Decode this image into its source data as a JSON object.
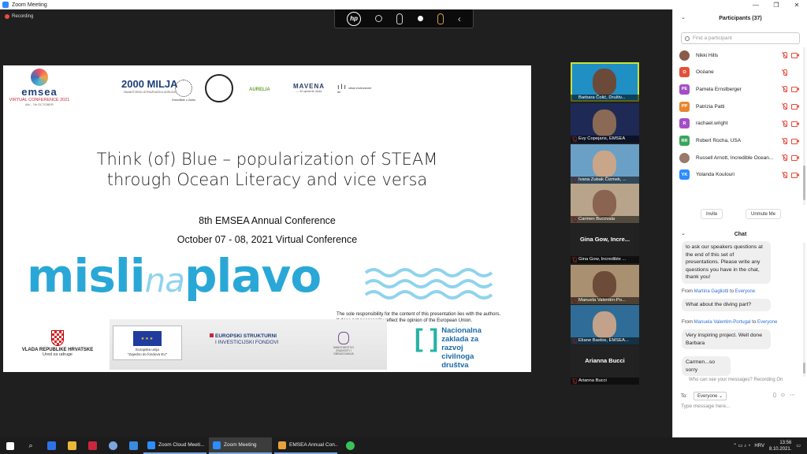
{
  "window": {
    "title": "Zoom Meeting",
    "recording_label": "Recording",
    "accent": "#2d8cff"
  },
  "hp_toolbar": {
    "logo": "hp",
    "icons": [
      "hp-logo-icon",
      "camera-circle-icon",
      "microphone-icon",
      "record-circle-icon",
      "microphone-active-icon",
      "collapse-arrow-icon"
    ]
  },
  "slide": {
    "logos": {
      "emsea": "emsea",
      "emsea_sub": "VIRTUAL CONFERENCE 2021",
      "emsea_dates": "8th - 7th OCTOBER",
      "milja": "2000 MILJA",
      "milja_sub": "ZNANSTVENO-ISTRAŽIVAČKA UDRUGA",
      "zadar": "Sveučilište u Zadru",
      "aurelia": "AURELIA",
      "mavena": "MAVENA",
      "mavena_sub": "— 30 sjevernih škola",
      "city": "urban environment art"
    },
    "title_line1": "Think (of) Blue – popularization of STEAM",
    "title_line2": "through Ocean Literacy and vice versa",
    "subtitle1": "8th EMSEA Annual Conference",
    "subtitle2": "October 07 - 08, 2021 Virtual Conference",
    "brand_misli": "misli",
    "brand_na": "na",
    "brand_plavo": "plavo",
    "disclaimer_line1": "The sole responsibility for the content of this presentation lies with the authors.",
    "disclaimer_line2": "It does not necessarily reflect the opinion of the European Union.",
    "croatia_line1": "VLADA REPUBLIKE HRVATSKE",
    "croatia_line2": "Ured za udruge",
    "eu_line1": "Europska unija",
    "eu_line2": "\"Zajedno do fondova EU\"",
    "esif_line1": "EUROPSKI STRUKTURNI",
    "esif_line2": "I INVESTICIJSKI FONDOVI",
    "ministarstvo": "MINISTARSTVO ZNANOSTI I OBRAZOVANJA",
    "nzrcd": [
      "Nacionalna",
      "zaklada za",
      "razvoj",
      "civilnoga",
      "društva"
    ]
  },
  "gallery": [
    {
      "name": "Barbara Čolić, Društv...",
      "active": true,
      "muted": false,
      "tile_color": "#1f8fc4",
      "face_color": "#6b4a3a"
    },
    {
      "name": "Evy Copejans, EMSEA",
      "active": false,
      "muted": true,
      "tile_color": "#1e2a55",
      "face_color": "#8a6a55"
    },
    {
      "name": "Ivana Zubak Čizmek, ...",
      "active": false,
      "muted": true,
      "tile_color": "#6aa0c6",
      "face_color": "#c9a58a"
    },
    {
      "name": "Carmen Bucovala",
      "active": false,
      "muted": true,
      "tile_color": "#b8a48a",
      "face_color": "#8a6450"
    },
    {
      "name": "Gina Gow, Incredible ...",
      "big_label": "Gina Gow, Incre...",
      "active": false,
      "muted": true,
      "tile_color": "#222222"
    },
    {
      "name": "Manuela Valentim-Po...",
      "active": false,
      "muted": true,
      "tile_color": "#a89070",
      "face_color": "#6c4c38"
    },
    {
      "name": "Eliane Bastos, EMSEA...",
      "active": false,
      "muted": true,
      "tile_color": "#2f6d98",
      "face_color": "#c2a28a"
    },
    {
      "name": "Arianna Bucci",
      "big_label": "Arianna Bucci",
      "active": false,
      "muted": true,
      "tile_color": "#222222"
    }
  ],
  "participants": {
    "header": "Participants (37)",
    "search_placeholder": "Find a participant",
    "list": [
      {
        "name": "Nikki Hills",
        "initials": "",
        "color": "#8a5a4a",
        "mic_muted": true,
        "cam_off": true
      },
      {
        "name": "Océane",
        "initials": "O",
        "color": "#e0533a",
        "mic_muted": true,
        "cam_off": false
      },
      {
        "name": "Pamela Ernstberger",
        "initials": "PE",
        "color": "#a44ec7",
        "mic_muted": true,
        "cam_off": true
      },
      {
        "name": "Patrizia Patti",
        "initials": "PP",
        "color": "#e8862e",
        "mic_muted": true,
        "cam_off": true
      },
      {
        "name": "rachael.wright",
        "initials": "R",
        "color": "#a44ec7",
        "mic_muted": true,
        "cam_off": true
      },
      {
        "name": "Robert Rocha, USA",
        "initials": "RR",
        "color": "#3aa55a",
        "mic_muted": true,
        "cam_off": true
      },
      {
        "name": "Russell Arnott, Incredible Ocean...",
        "initials": "",
        "color": "#9a7a6a",
        "mic_muted": true,
        "cam_off": true
      },
      {
        "name": "Yolanda Koulouri",
        "initials": "YK",
        "color": "#2d8cff",
        "mic_muted": true,
        "cam_off": true
      }
    ],
    "invite_label": "Invite",
    "unmute_label": "Unmute Me"
  },
  "chat": {
    "header": "Chat",
    "messages": [
      {
        "from": "",
        "to": "",
        "text": "to ask our speakers questions at the end of this set of presentations. Please write any questions you have in the chat, thank you!"
      },
      {
        "from": "Martina Gagliotti",
        "to": "Everyone",
        "text": "What about the diving part?"
      },
      {
        "from": "Manuela Valentim-Portugal",
        "to": "Everyone",
        "text": "Very inspiring project. Well done Barbara"
      },
      {
        "from": "",
        "to": "",
        "text": "Carmen...so sorry"
      }
    ],
    "from_word": "From",
    "to_word": "to",
    "who_can_see": "Who can see your messages? Recording On",
    "to_label": "To:",
    "recipient": "Everyone",
    "input_placeholder": "Type message here..."
  },
  "taskbar": {
    "apps": [
      {
        "label": "Zoom Cloud Meeti...",
        "color": "#2d8cff",
        "active": false
      },
      {
        "label": "Zoom Meeting",
        "color": "#2d8cff",
        "active": true
      },
      {
        "label": "EMSEA Annual Con...",
        "color": "#e8a23a",
        "active": false
      }
    ],
    "language": "HRV",
    "time": "13:56",
    "date": "8.10.2021."
  }
}
